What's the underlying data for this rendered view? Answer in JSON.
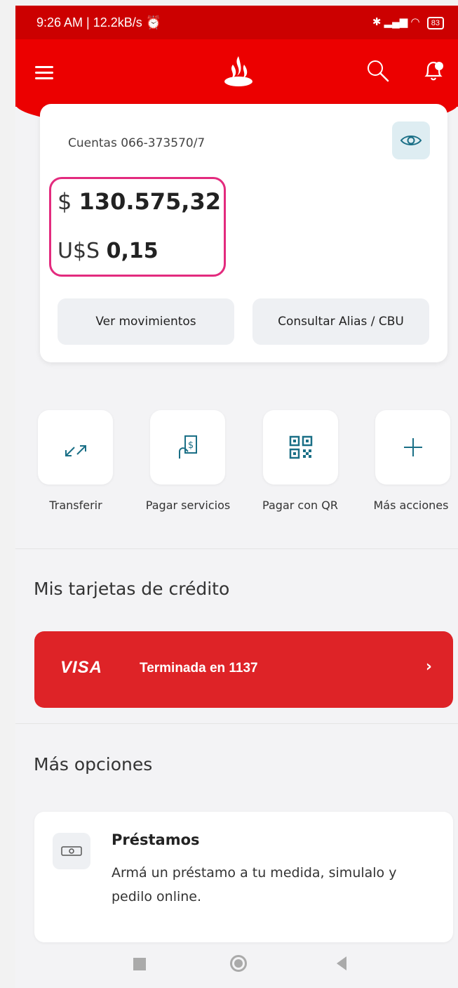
{
  "status_bar": {
    "left_text": "9:26 AM | 12.2kB/s",
    "alarm_icon": "alarm-icon",
    "battery": "83"
  },
  "header": {
    "menu_icon": "hamburger-menu-icon",
    "logo_icon": "santander-flame-icon",
    "search_icon": "search-icon",
    "notifications_icon": "bell-icon"
  },
  "account": {
    "label": "Cuentas 066-373570/7",
    "ars_symbol": "$",
    "ars_amount": "130.575,32",
    "usd_symbol": "U$S",
    "usd_amount": "0,15",
    "btn_movements": "Ver movimientos",
    "btn_alias": "Consultar Alias / CBU"
  },
  "quick_actions": [
    {
      "label": "Transferir",
      "icon": "transfer-arrows-icon"
    },
    {
      "label": "Pagar servicios",
      "icon": "pay-bill-hand-icon"
    },
    {
      "label": "Pagar con QR",
      "icon": "qr-code-icon"
    },
    {
      "label": "Más acciones",
      "icon": "plus-icon"
    }
  ],
  "credit_cards": {
    "title": "Mis tarjetas de crédito",
    "card_brand": "VISA",
    "card_text": "Terminada en  1137"
  },
  "more_options": {
    "title": "Más opciones",
    "loan_title": "Préstamos",
    "loan_desc": "Armá un préstamo a tu medida, simulalo y pedilo online."
  },
  "colors": {
    "brand_red": "#ec0000",
    "highlight_pink": "#e32b7e",
    "visa_red": "#de2327"
  }
}
